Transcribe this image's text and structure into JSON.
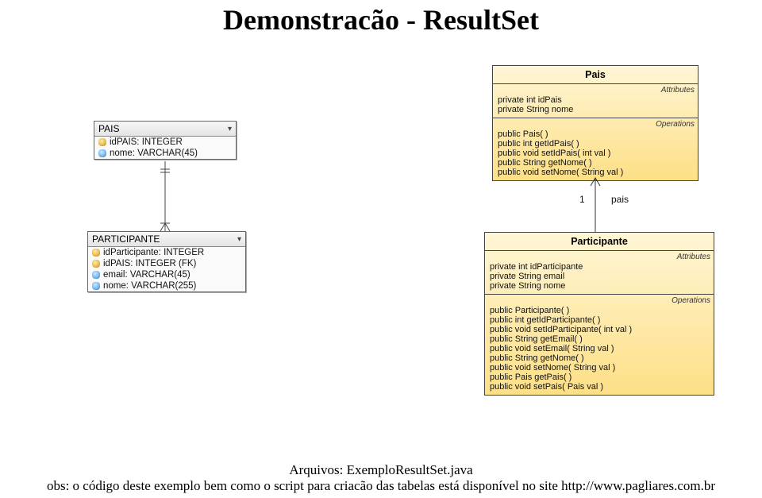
{
  "title": "Demonstracão - ResultSet",
  "db_tables": {
    "pais": {
      "name": "PAIS",
      "cols": [
        {
          "pk": true,
          "label": "idPAIS: INTEGER"
        },
        {
          "pk": false,
          "label": "nome: VARCHAR(45)"
        }
      ]
    },
    "participante": {
      "name": "PARTICIPANTE",
      "cols": [
        {
          "pk": true,
          "label": "idParticipante: INTEGER"
        },
        {
          "pk": true,
          "label": "idPAIS: INTEGER (FK)"
        },
        {
          "pk": false,
          "label": "email: VARCHAR(45)"
        },
        {
          "pk": false,
          "label": "nome: VARCHAR(255)"
        }
      ]
    }
  },
  "uml": {
    "pais": {
      "name": "Pais",
      "attributes_label": "Attributes",
      "operations_label": "Operations",
      "attributes": [
        "private int idPais",
        "private String nome"
      ],
      "operations": [
        "public Pais( )",
        "public int  getIdPais( )",
        "public void  setIdPais( int val )",
        "public String  getNome( )",
        "public void  setNome( String val )"
      ]
    },
    "participante": {
      "name": "Participante",
      "attributes_label": "Attributes",
      "operations_label": "Operations",
      "attributes": [
        "private int idParticipante",
        "private String email",
        "private String nome"
      ],
      "operations": [
        "public Participante( )",
        "public int  getIdParticipante( )",
        "public void  setIdParticipante( int val )",
        "public String  getEmail( )",
        "public void  setEmail( String val )",
        "public String  getNome( )",
        "public void  setNome( String val )",
        "public Pais  getPais( )",
        "public void  setPais( Pais val )"
      ]
    },
    "assoc": {
      "multiplicity": "1",
      "role": "pais"
    }
  },
  "caption": {
    "line1": "Arquivos: ExemploResultSet.java",
    "line2a": "obs: o código deste exemplo bem como o script para criacão das tabelas  está disponível no site ",
    "line2b": "http://www.pagliares.com.br"
  }
}
